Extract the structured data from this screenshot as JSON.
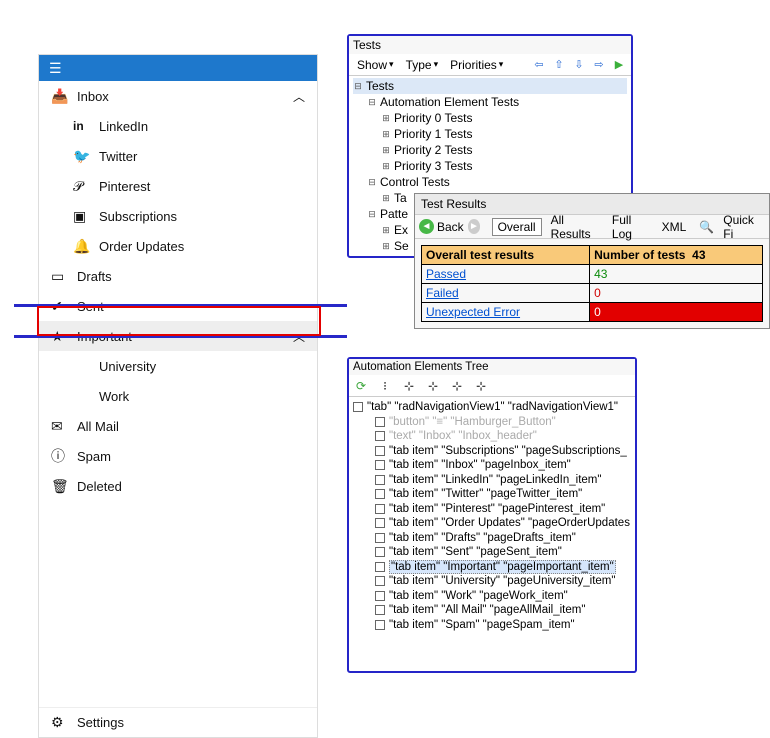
{
  "sidebar": {
    "items": [
      {
        "icon": "📥",
        "label": "Inbox",
        "chevron": "⌃",
        "sub": false
      },
      {
        "icon": "in",
        "label": "LinkedIn",
        "sub": true
      },
      {
        "icon": "🐦",
        "label": "Twitter",
        "sub": true
      },
      {
        "icon": "𝒫",
        "label": "Pinterest",
        "sub": true
      },
      {
        "icon": "▣",
        "label": "Subscriptions",
        "sub": true
      },
      {
        "icon": "🔔",
        "label": "Order Updates",
        "sub": true
      },
      {
        "icon": "▭",
        "label": "Drafts",
        "sub": false
      },
      {
        "icon": "✔",
        "label": "Sent",
        "sub": false
      },
      {
        "icon": "★",
        "label": "Important",
        "chevron": "⌃",
        "sub": false,
        "important": true
      },
      {
        "icon": "",
        "label": "University",
        "sub": true
      },
      {
        "icon": "",
        "label": "Work",
        "sub": true
      },
      {
        "icon": "✉",
        "label": "All Mail",
        "sub": false
      },
      {
        "icon": "ⓘ",
        "label": "Spam",
        "sub": false
      },
      {
        "icon": "🗑",
        "label": "Deleted",
        "sub": false
      }
    ],
    "settings": {
      "icon": "⚙",
      "label": "Settings"
    }
  },
  "tests": {
    "title": "Tests",
    "toolbar": {
      "show": "Show",
      "type": "Type",
      "priorities": "Priorities"
    },
    "tree": [
      {
        "l": 0,
        "exp": "⊟",
        "label": "Tests",
        "sel": true
      },
      {
        "l": 1,
        "exp": "⊟",
        "label": "Automation Element Tests"
      },
      {
        "l": 2,
        "exp": "⊞",
        "label": "Priority 0 Tests"
      },
      {
        "l": 2,
        "exp": "⊞",
        "label": "Priority 1 Tests"
      },
      {
        "l": 2,
        "exp": "⊞",
        "label": "Priority 2 Tests"
      },
      {
        "l": 2,
        "exp": "⊞",
        "label": "Priority 3 Tests"
      },
      {
        "l": 1,
        "exp": "⊟",
        "label": "Control Tests"
      },
      {
        "l": 2,
        "exp": "⊞",
        "label": "Ta"
      },
      {
        "l": 1,
        "exp": "⊟",
        "label": "Patte"
      },
      {
        "l": 2,
        "exp": "⊞",
        "label": "Ex"
      },
      {
        "l": 2,
        "exp": "⊞",
        "label": "Se"
      }
    ]
  },
  "results": {
    "title": "Test Results",
    "toolbar": {
      "back": "Back",
      "tabs": [
        "Overall",
        "All Results",
        "Full Log",
        "XML"
      ],
      "quick": "Quick Fi"
    },
    "table": {
      "head": [
        "Overall test results",
        "Number of tests",
        "43"
      ],
      "rows": [
        {
          "label": "Passed",
          "value": "43",
          "cls": "green"
        },
        {
          "label": "Failed",
          "value": "0",
          "cls": "red"
        },
        {
          "label": "Unexpected Error",
          "value": "0",
          "cls": "redbg"
        }
      ]
    }
  },
  "auto": {
    "title": "Automation Elements Tree",
    "rows": [
      {
        "l": 0,
        "grey": false,
        "label": "\"tab\" \"radNavigationView1\" \"radNavigationView1\""
      },
      {
        "l": 1,
        "grey": true,
        "label": "\"button\" \"≡\" \"Hamburger_Button\""
      },
      {
        "l": 1,
        "grey": true,
        "label": "\"text\" \"Inbox\" \"Inbox_header\""
      },
      {
        "l": 1,
        "grey": false,
        "label": "\"tab item\" \"Subscriptions\" \"pageSubscriptions_"
      },
      {
        "l": 1,
        "grey": false,
        "label": "\"tab item\" \"Inbox\" \"pageInbox_item\""
      },
      {
        "l": 1,
        "grey": false,
        "label": "\"tab item\" \"LinkedIn\" \"pageLinkedIn_item\""
      },
      {
        "l": 1,
        "grey": false,
        "label": "\"tab item\" \"Twitter\" \"pageTwitter_item\""
      },
      {
        "l": 1,
        "grey": false,
        "label": "\"tab item\" \"Pinterest\" \"pagePinterest_item\""
      },
      {
        "l": 1,
        "grey": false,
        "label": "\"tab item\" \"Order Updates\" \"pageOrderUpdates"
      },
      {
        "l": 1,
        "grey": false,
        "label": "\"tab item\" \"Drafts\" \"pageDrafts_item\""
      },
      {
        "l": 1,
        "grey": false,
        "label": "\"tab item\" \"Sent\" \"pageSent_item\""
      },
      {
        "l": 1,
        "grey": false,
        "label": "\"tab item\" \"Important\" \"pageImportant_item\"",
        "hl": true
      },
      {
        "l": 1,
        "grey": false,
        "label": "\"tab item\" \"University\" \"pageUniversity_item\""
      },
      {
        "l": 1,
        "grey": false,
        "label": "\"tab item\" \"Work\" \"pageWork_item\""
      },
      {
        "l": 1,
        "grey": false,
        "label": "\"tab item\" \"All Mail\" \"pageAllMail_item\""
      },
      {
        "l": 1,
        "grey": false,
        "label": "\"tab item\" \"Spam\" \"pageSpam_item\""
      }
    ]
  }
}
